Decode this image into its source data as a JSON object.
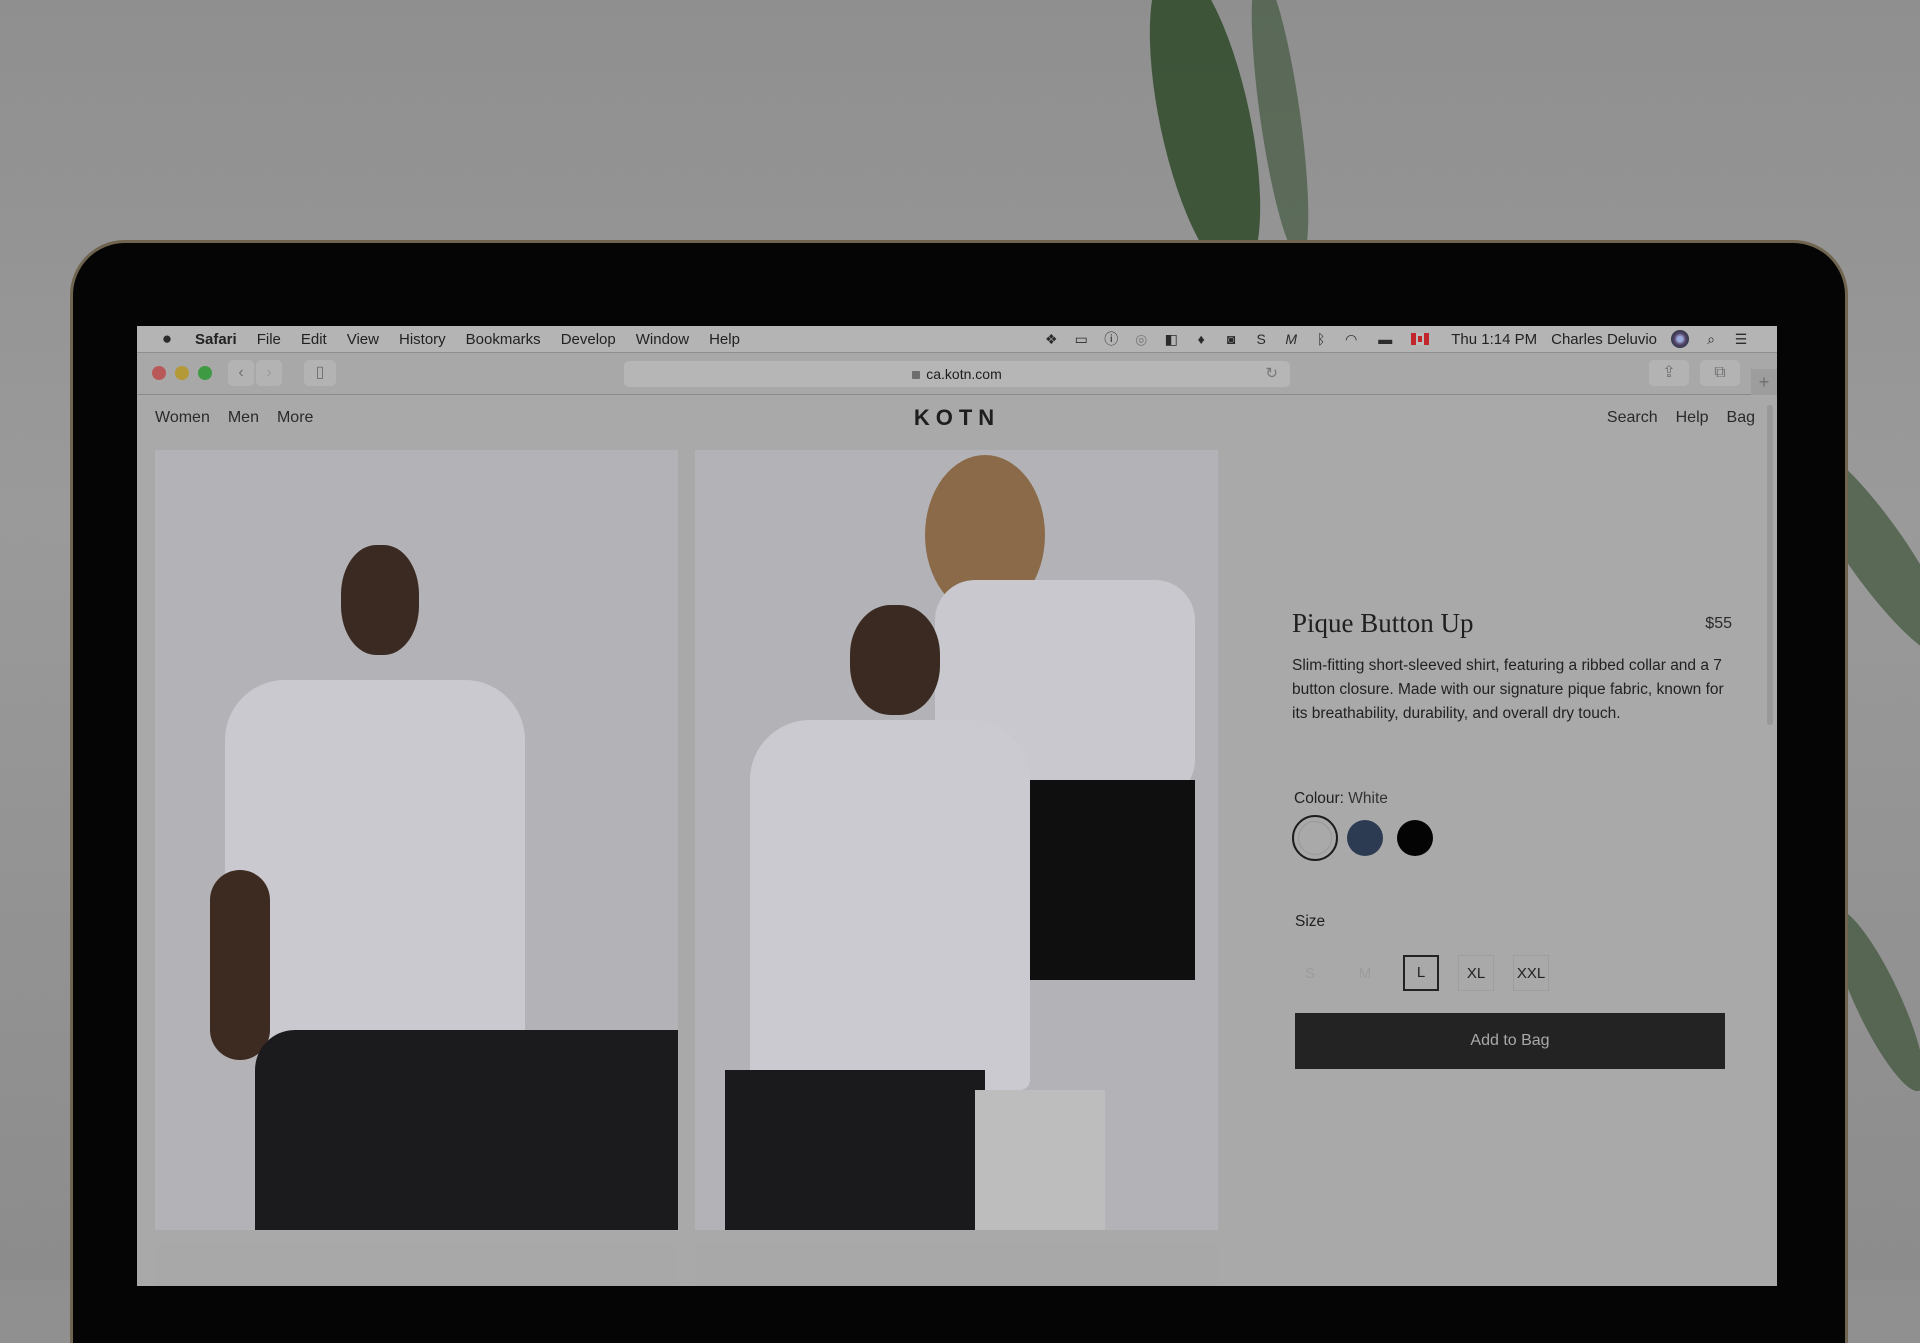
{
  "menubar": {
    "apple_icon": "apple-logo-icon",
    "app_name": "Safari",
    "menus": [
      "File",
      "Edit",
      "View",
      "History",
      "Bookmarks",
      "Develop",
      "Window",
      "Help"
    ],
    "status_icons": [
      "dropbox-icon",
      "display-icon",
      "1password-icon",
      "creative-cloud-icon",
      "clipboard-icon",
      "sketch-icon",
      "screenshot-camera-icon",
      "s-icon",
      "m-icon",
      "bluetooth-icon",
      "wifi-icon",
      "battery-icon",
      "canada-flag-icon"
    ],
    "clock": "Thu 1:14 PM",
    "user": "Charles Deluvio"
  },
  "toolbar": {
    "back_glyph": "‹",
    "forward_glyph": "›",
    "url": "ca.kotn.com",
    "reload_glyph": "↻",
    "share_glyph": "⇪",
    "tabs_glyph": "⧉",
    "new_tab_glyph": "+"
  },
  "site": {
    "logo": "KOTN",
    "nav_left": [
      "Women",
      "Men",
      "More"
    ],
    "nav_right": [
      "Search",
      "Help",
      "Bag"
    ]
  },
  "product": {
    "title": "Pique Button Up",
    "price": "$55",
    "description": "Slim-fitting short-sleeved shirt, featuring a ribbed collar and a 7 button closure. Made with our signature pique fabric, known for its breathability, durability, and overall dry touch.",
    "colour_label": "Colour:",
    "colour_value": "White",
    "colours": [
      {
        "name": "White",
        "hex": "#ffffff",
        "selected": true
      },
      {
        "name": "Navy",
        "hex": "#2c3a52",
        "selected": false
      },
      {
        "name": "Black",
        "hex": "#000000",
        "selected": false
      }
    ],
    "size_label": "Size",
    "sizes": [
      {
        "label": "S",
        "available": false,
        "selected": false
      },
      {
        "label": "M",
        "available": false,
        "selected": false
      },
      {
        "label": "L",
        "available": true,
        "selected": true
      },
      {
        "label": "XL",
        "available": true,
        "selected": false
      },
      {
        "label": "XXL",
        "available": true,
        "selected": false
      }
    ],
    "add_button": "Add to Bag"
  }
}
